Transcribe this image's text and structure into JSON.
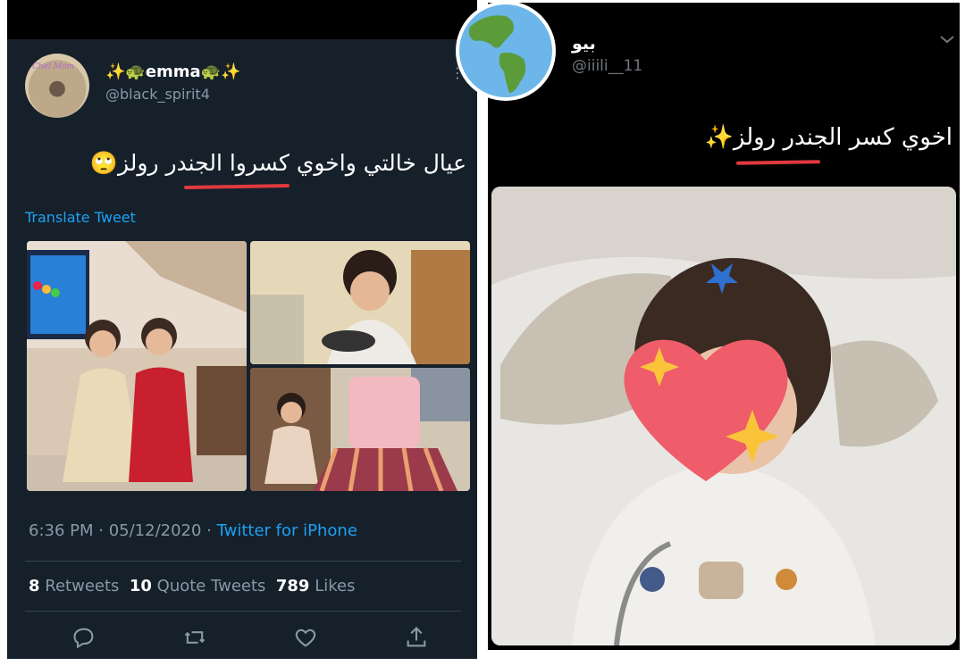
{
  "left_tweet": {
    "display_name": "✨🐢emma🐢✨",
    "handle": "@black_spirit4",
    "more_glyph": "⋮",
    "avatar_text": "Chel Mom",
    "text": "عيال خالتي واخوي كسروا الجندر رولز🙄",
    "translate_label": "Translate Tweet",
    "time": "6:36 PM · 05/12/2020 · ",
    "source": "Twitter for iPhone",
    "retweets_count": "8",
    "retweets_label": "Retweets",
    "quotes_count": "10",
    "quotes_label": "Quote Tweets",
    "likes_count": "789",
    "likes_label": "Likes",
    "photos": [
      "two-girls-dresses-photo",
      "boy-playing-photo",
      "boy-in-skirt-photo"
    ],
    "colors": {
      "background": "#15202b",
      "accent": "#1da1f2",
      "underline": "#e0393e"
    }
  },
  "right_tweet": {
    "display_name": "بيو",
    "handle": "@iiili__11",
    "text": "اخوي كسر الجندر رولز✨",
    "photo": "toddler-with-heart-sticker-photo",
    "colors": {
      "background": "#000000",
      "underline": "#e0393e"
    }
  }
}
